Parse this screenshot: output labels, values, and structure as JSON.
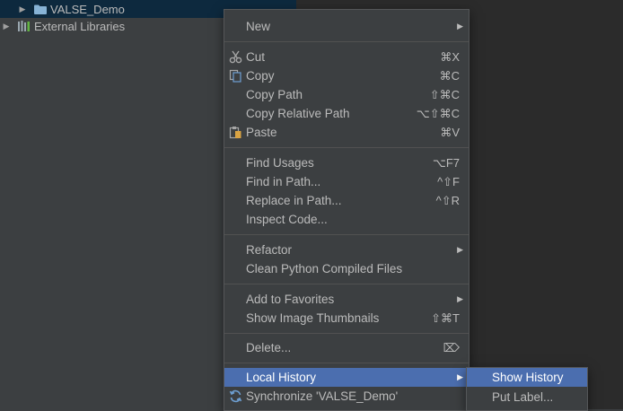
{
  "project_tree": {
    "items": [
      {
        "label": "VALSE_Demo",
        "icon": "folder-icon",
        "expanded": false,
        "selected": true
      },
      {
        "label": "External Libraries",
        "icon": "library-icon",
        "expanded": false,
        "selected": false
      }
    ]
  },
  "context_menu": {
    "new": {
      "label": "New",
      "arrow": "▶"
    },
    "cut": {
      "label": "Cut",
      "shortcut": "⌘X",
      "icon": "scissors-icon"
    },
    "copy": {
      "label": "Copy",
      "shortcut": "⌘C",
      "icon": "copy-icon"
    },
    "copy_path": {
      "label": "Copy Path",
      "shortcut": "⇧⌘C"
    },
    "copy_relative_path": {
      "label": "Copy Relative Path",
      "shortcut": "⌥⇧⌘C"
    },
    "paste": {
      "label": "Paste",
      "shortcut": "⌘V",
      "icon": "paste-icon"
    },
    "find_usages": {
      "label": "Find Usages",
      "shortcut": "⌥F7"
    },
    "find_in_path": {
      "label": "Find in Path...",
      "shortcut": "^⇧F"
    },
    "replace_in_path": {
      "label": "Replace in Path...",
      "shortcut": "^⇧R"
    },
    "inspect_code": {
      "label": "Inspect Code..."
    },
    "refactor": {
      "label": "Refactor",
      "arrow": "▶"
    },
    "clean_python": {
      "label": "Clean Python Compiled Files"
    },
    "add_to_favorites": {
      "label": "Add to Favorites",
      "arrow": "▶"
    },
    "show_image_thumbnails": {
      "label": "Show Image Thumbnails",
      "shortcut": "⇧⌘T"
    },
    "delete": {
      "label": "Delete...",
      "shortcut": "⌦"
    },
    "local_history": {
      "label": "Local History",
      "arrow": "▶",
      "highlighted": true
    },
    "synchronize": {
      "label": "Synchronize 'VALSE_Demo'",
      "icon": "sync-icon"
    }
  },
  "local_history_submenu": {
    "show_history": {
      "label": "Show History",
      "highlighted": true
    },
    "put_label": {
      "label": "Put Label..."
    }
  },
  "colors": {
    "panel_bg": "#3c3f41",
    "editor_bg": "#2b2b2b",
    "highlight": "#4b6eaf",
    "selected_row": "#0d293e",
    "text": "#bbbbbb"
  }
}
